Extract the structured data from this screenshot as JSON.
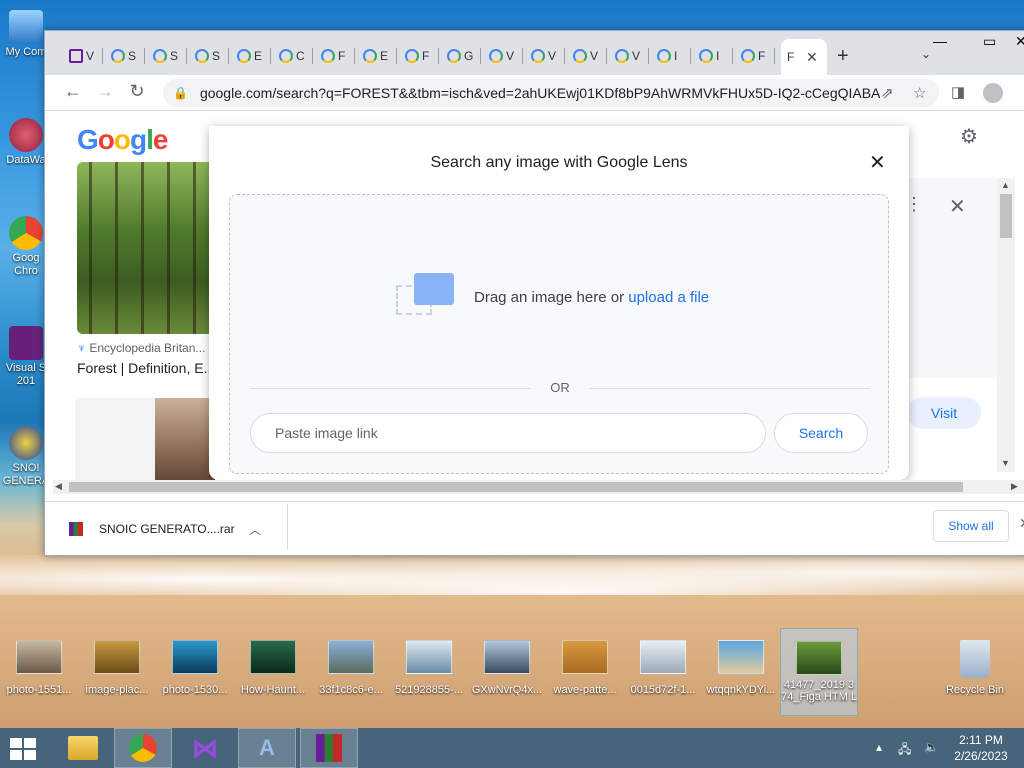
{
  "desktop": {
    "left_icons": [
      {
        "label": "My Com"
      },
      {
        "label": "DataWa"
      },
      {
        "label": "Goog Chro"
      },
      {
        "label": "Visual S 201"
      },
      {
        "label": "SNOI GENERA"
      }
    ],
    "bottom_icons": [
      {
        "label": "photo-1551..."
      },
      {
        "label": "image-plac..."
      },
      {
        "label": "photo-1530..."
      },
      {
        "label": "How-Haunt..."
      },
      {
        "label": "33f1c8c6-e..."
      },
      {
        "label": "521928855-..."
      },
      {
        "label": "GXwNvrQ4x..."
      },
      {
        "label": "wave-patte..."
      },
      {
        "label": "0015d72f-1..."
      },
      {
        "label": "wtqqnkYDYi..."
      },
      {
        "label": "41477_2019 3 74_Figa HTM L"
      }
    ],
    "recycle_bin": "Recycle Bin"
  },
  "browser": {
    "tabs": [
      "V",
      "S",
      "S",
      "S",
      "E",
      "C",
      "F",
      "E",
      "F",
      "G",
      "V",
      "V",
      "V",
      "V",
      "I",
      "I",
      "F"
    ],
    "active_tab": "F",
    "new_tab": "+",
    "url": "google.com/search?q=FOREST&&tbm=isch&ved=2ahUKEwj01KDf8bP9AhWRMVkFHUx5D-IQ2-cCegQIABA..."
  },
  "page": {
    "logo": "Google",
    "result": {
      "source": "Encyclopedia Britan...",
      "title": "Forest | Definition, E..."
    },
    "visit": "Visit"
  },
  "lens": {
    "title": "Search any image with Google Lens",
    "drag_text": "Drag an image here or ",
    "upload_link": "upload a file",
    "or": "OR",
    "link_placeholder": "Paste image link",
    "search": "Search"
  },
  "downloads": {
    "file": "SNOIC GENERATO....rar",
    "show_all": "Show all"
  },
  "taskbar": {
    "time": "2:11 PM",
    "date": "2/26/2023"
  }
}
